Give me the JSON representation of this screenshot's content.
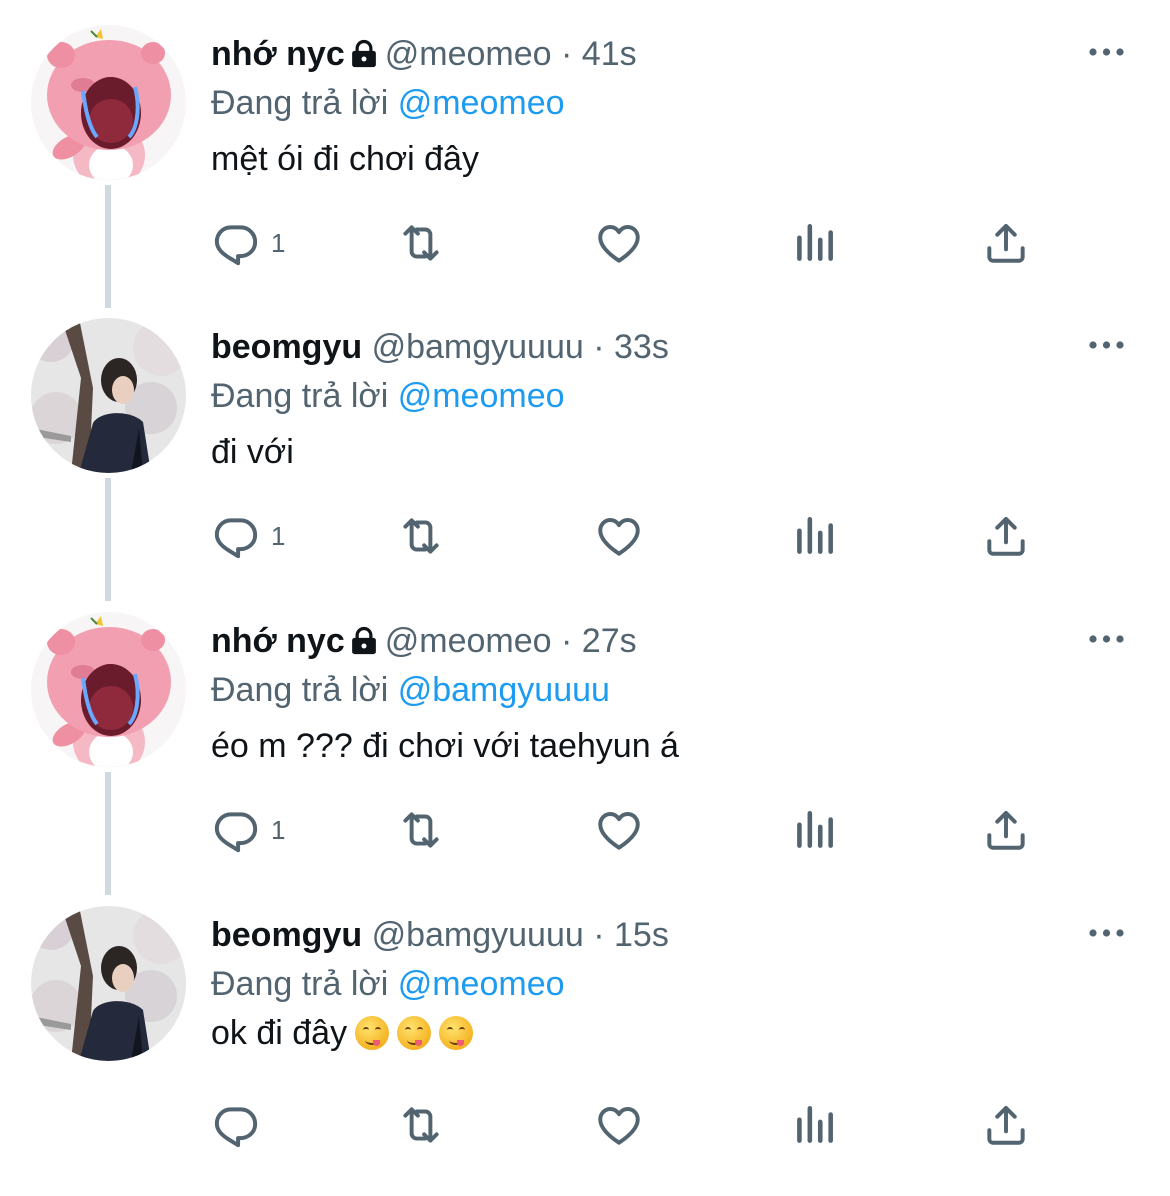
{
  "tweets": [
    {
      "name": "nhớ nyc",
      "locked": true,
      "handle": "@meomeo",
      "separator": "·",
      "time": "41s",
      "replying_prefix": "Đang trả lời",
      "replying_to": "@meomeo",
      "text": "mệt ói đi chơi đây",
      "reply_count": "1",
      "avatar": "pink-cartoon-crying"
    },
    {
      "name": "beomgyu",
      "locked": false,
      "handle": "@bamgyuuuu",
      "separator": "·",
      "time": "33s",
      "replying_prefix": "Đang trả lời",
      "replying_to": "@meomeo",
      "text": "đi với",
      "reply_count": "1",
      "avatar": "person-photo-blossoms"
    },
    {
      "name": "nhớ nyc",
      "locked": true,
      "handle": "@meomeo",
      "separator": "·",
      "time": "27s",
      "replying_prefix": "Đang trả lời",
      "replying_to": "@bamgyuuuu",
      "text": "éo m ??? đi chơi với taehyun á",
      "reply_count": "1",
      "avatar": "pink-cartoon-crying"
    },
    {
      "name": "beomgyu",
      "locked": false,
      "handle": "@bamgyuuuu",
      "separator": "·",
      "time": "15s",
      "replying_prefix": "Đang trả lời",
      "replying_to": "@meomeo",
      "text": "ok đi đây",
      "emoji": [
        "yum-face-emoji",
        "yum-face-emoji",
        "yum-face-emoji"
      ],
      "reply_count": "",
      "avatar": "person-photo-blossoms"
    }
  ],
  "colors": {
    "accent": "#1d9bf0",
    "secondary_text": "#536471",
    "thread_line": "#cfd9de",
    "icon": "#536471"
  },
  "icons": [
    "more-icon",
    "reply-icon",
    "retweet-icon",
    "like-icon",
    "views-icon",
    "share-icon",
    "lock-icon"
  ]
}
